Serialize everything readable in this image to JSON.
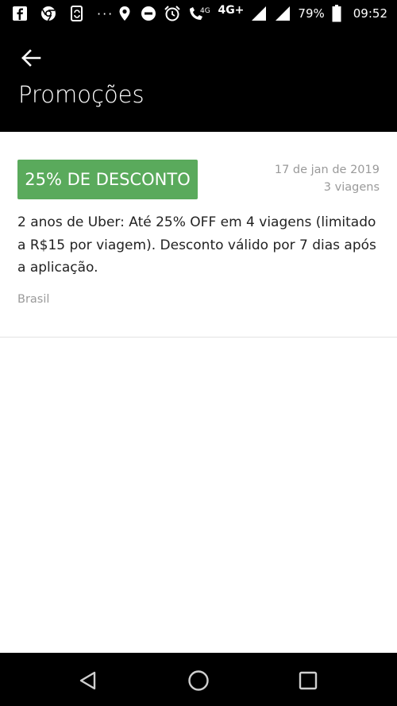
{
  "status_bar": {
    "dots": "···",
    "network": "4G+",
    "small_network": "4G",
    "battery": "79%",
    "time": "09:52",
    "icons": [
      "facebook-icon",
      "chrome-icon",
      "sync-icon",
      "location-icon",
      "do-not-disturb-icon",
      "alarm-icon",
      "wifi-call-icon",
      "signal-icon",
      "battery-icon"
    ]
  },
  "header": {
    "title": "Promoções",
    "back_icon": "arrow-left-icon"
  },
  "promo": {
    "badge": "25% DE DESCONTO",
    "date": "17 de jan de 2019",
    "trips": "3 viagens",
    "description": "2 anos de Uber: Até 25% OFF em 4 viagens (limitado a R$15 por viagem). Desconto válido por 7 dias após a aplicação.",
    "region": "Brasil",
    "badge_color": "#5aaa5c"
  },
  "nav": {
    "icons": [
      "back-triangle-icon",
      "home-circle-icon",
      "recents-square-icon"
    ]
  }
}
